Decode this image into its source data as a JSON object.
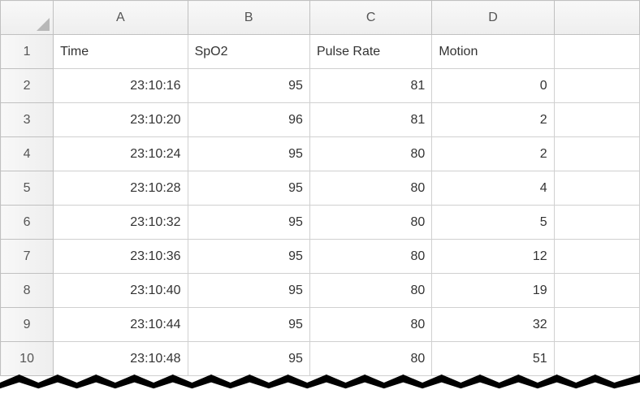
{
  "columns": [
    "A",
    "B",
    "C",
    "D"
  ],
  "headers": {
    "A": "Time",
    "B": "SpO2",
    "C": "Pulse Rate",
    "D": "Motion"
  },
  "rows": [
    {
      "n": "1"
    },
    {
      "n": "2",
      "A": "23:10:16",
      "B": "95",
      "C": "81",
      "D": "0"
    },
    {
      "n": "3",
      "A": "23:10:20",
      "B": "96",
      "C": "81",
      "D": "2"
    },
    {
      "n": "4",
      "A": "23:10:24",
      "B": "95",
      "C": "80",
      "D": "2"
    },
    {
      "n": "5",
      "A": "23:10:28",
      "B": "95",
      "C": "80",
      "D": "4"
    },
    {
      "n": "6",
      "A": "23:10:32",
      "B": "95",
      "C": "80",
      "D": "5"
    },
    {
      "n": "7",
      "A": "23:10:36",
      "B": "95",
      "C": "80",
      "D": "12"
    },
    {
      "n": "8",
      "A": "23:10:40",
      "B": "95",
      "C": "80",
      "D": "19"
    },
    {
      "n": "9",
      "A": "23:10:44",
      "B": "95",
      "C": "80",
      "D": "32"
    },
    {
      "n": "10",
      "A": "23:10:48",
      "B": "95",
      "C": "80",
      "D": "51"
    }
  ]
}
